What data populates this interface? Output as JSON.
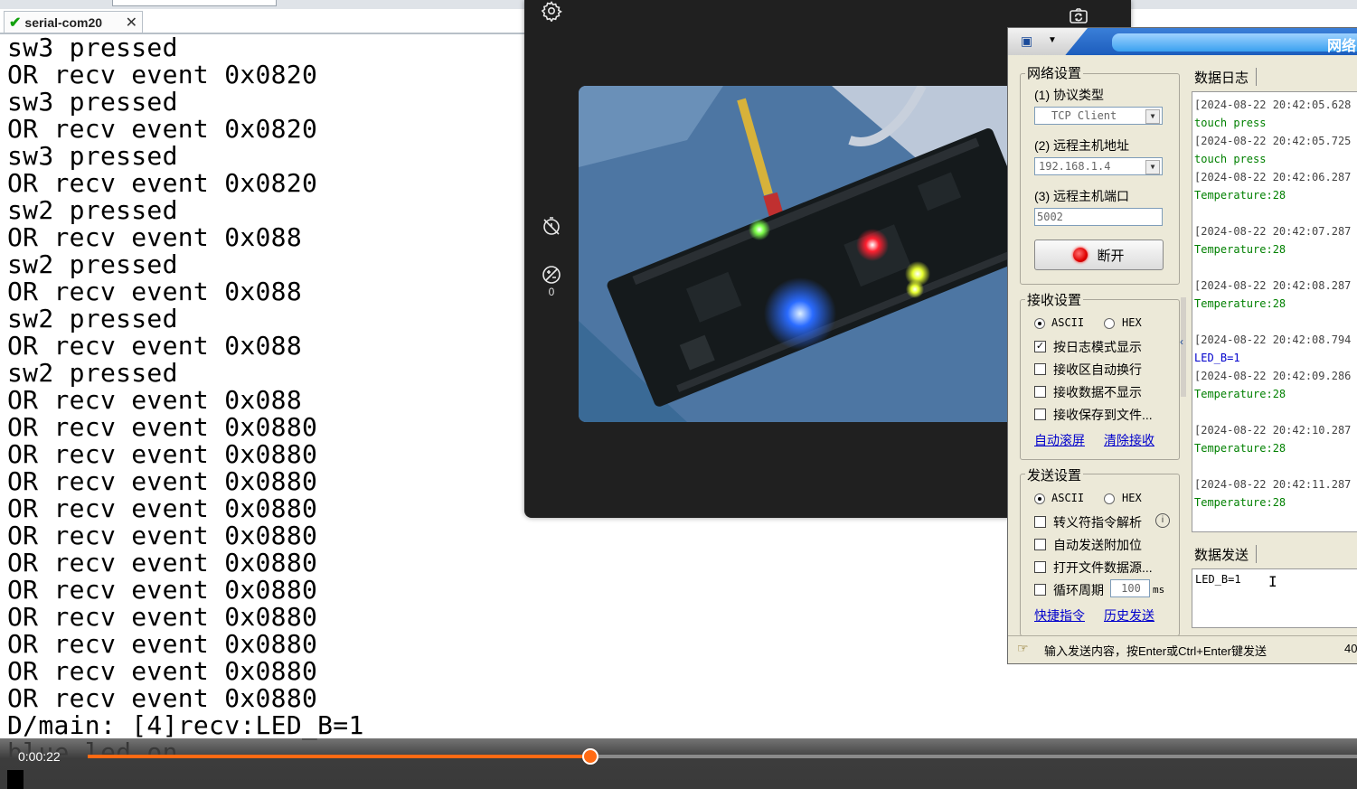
{
  "serial": {
    "tab_label": "serial-com20",
    "lines": [
      "sw3 pressed",
      "OR recv event 0x0820",
      "sw3 pressed",
      "OR recv event 0x0820",
      "sw3 pressed",
      "OR recv event 0x0820",
      "sw2 pressed",
      "OR recv event 0x088",
      "sw2 pressed",
      "OR recv event 0x088",
      "sw2 pressed",
      "OR recv event 0x088",
      "sw2 pressed",
      "OR recv event 0x088",
      "OR recv event 0x0880",
      "OR recv event 0x0880",
      "OR recv event 0x0880",
      "OR recv event 0x0880",
      "OR recv event 0x0880",
      "OR recv event 0x0880",
      "OR recv event 0x0880",
      "OR recv event 0x0880",
      "OR recv event 0x0880",
      "OR recv event 0x0880",
      "OR recv event 0x0880",
      "D/main: [4]recv:LED_B=1",
      "blue led on"
    ]
  },
  "camera": {
    "timer_count": "0",
    "icons": [
      "gear-icon",
      "switch-camera-icon",
      "timer-off-icon",
      "exposure-icon"
    ]
  },
  "net": {
    "title": "网络",
    "network_group": "网络设置",
    "protocol_label": "(1) 协议类型",
    "protocol_value": "TCP Client",
    "host_label": "(2) 远程主机地址",
    "host_value": "192.168.1.4",
    "port_label": "(3) 远程主机端口",
    "port_value": "5002",
    "disconnect_label": "断开",
    "recv_group": "接收设置",
    "recv_ascii": "ASCII",
    "recv_hex": "HEX",
    "recv_log_mode": "按日志模式显示",
    "recv_auto_wrap": "接收区自动换行",
    "recv_hide": "接收数据不显示",
    "recv_save": "接收保存到文件...",
    "auto_scroll": "自动滚屏",
    "clear_recv": "清除接收",
    "send_group": "发送设置",
    "send_ascii": "ASCII",
    "send_hex": "HEX",
    "send_escape": "转义符指令解析",
    "send_append": "自动发送附加位",
    "send_file": "打开文件数据源...",
    "send_cycle": "循环周期",
    "cycle_value": "100",
    "cycle_unit": "ms",
    "shortcut": "快捷指令",
    "history": "历史发送",
    "log_tab": "数据日志",
    "send_tab": "数据发送",
    "send_text": "LED_B=1",
    "status_hint": "输入发送内容，按Enter或Ctrl+Enter键发送",
    "status_count": "40",
    "log_lines": [
      {
        "text": "[2024-08-22 20:42:05.628",
        "color": "#444444"
      },
      {
        "text": "touch press",
        "color": "#008000"
      },
      {
        "text": "[2024-08-22 20:42:05.725",
        "color": "#444444"
      },
      {
        "text": "touch press",
        "color": "#008000"
      },
      {
        "text": "[2024-08-22 20:42:06.287",
        "color": "#444444"
      },
      {
        "text": "Temperature:28",
        "color": "#008000"
      },
      {
        "text": "",
        "color": "#444444"
      },
      {
        "text": "[2024-08-22 20:42:07.287",
        "color": "#444444"
      },
      {
        "text": "Temperature:28",
        "color": "#008000"
      },
      {
        "text": "",
        "color": "#444444"
      },
      {
        "text": "[2024-08-22 20:42:08.287",
        "color": "#444444"
      },
      {
        "text": "Temperature:28",
        "color": "#008000"
      },
      {
        "text": "",
        "color": "#444444"
      },
      {
        "text": "[2024-08-22 20:42:08.794",
        "color": "#444444"
      },
      {
        "text": "LED_B=1",
        "color": "#0000cc"
      },
      {
        "text": "[2024-08-22 20:42:09.286",
        "color": "#444444"
      },
      {
        "text": "Temperature:28",
        "color": "#008000"
      },
      {
        "text": "",
        "color": "#444444"
      },
      {
        "text": "[2024-08-22 20:42:10.287",
        "color": "#444444"
      },
      {
        "text": "Temperature:28",
        "color": "#008000"
      },
      {
        "text": "",
        "color": "#444444"
      },
      {
        "text": "[2024-08-22 20:42:11.287",
        "color": "#444444"
      },
      {
        "text": "Temperature:28",
        "color": "#008000"
      }
    ]
  },
  "player": {
    "timecode": "0:00:22",
    "progress_fraction": 0.396,
    "accent": "#ff6a13"
  }
}
